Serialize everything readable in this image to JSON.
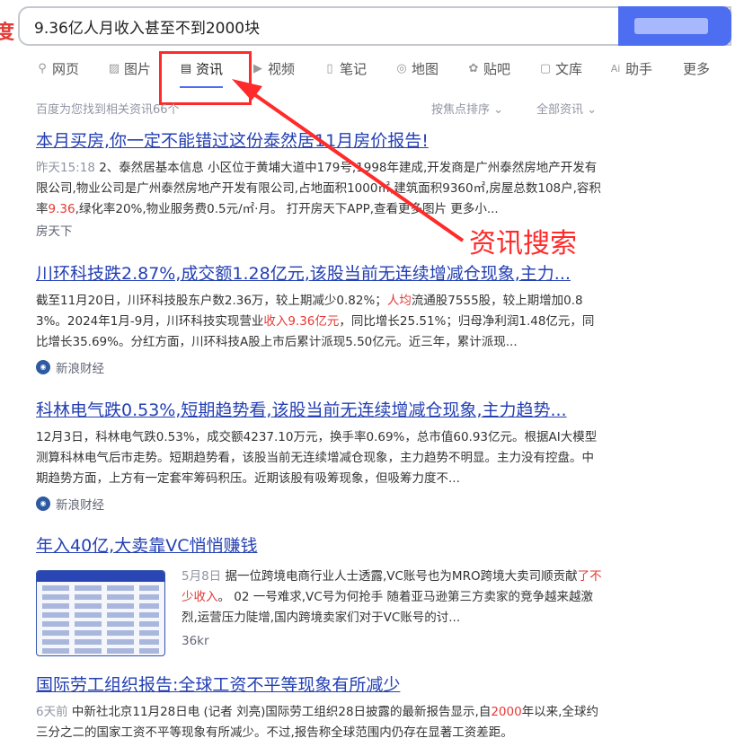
{
  "search": {
    "query": "9.36亿人月收入甚至不到2000块",
    "edge_char": "度"
  },
  "tabs": [
    {
      "label": "网页",
      "icon": "search-icon"
    },
    {
      "label": "图片",
      "icon": "image-icon"
    },
    {
      "label": "资讯",
      "icon": "news-icon",
      "active": true
    },
    {
      "label": "视频",
      "icon": "video-icon"
    },
    {
      "label": "笔记",
      "icon": "note-icon"
    },
    {
      "label": "地图",
      "icon": "map-pin-icon"
    },
    {
      "label": "贴吧",
      "icon": "paw-icon"
    },
    {
      "label": "文库",
      "icon": "document-icon"
    },
    {
      "label": "助手",
      "icon": "ai-icon"
    },
    {
      "label": "更多",
      "icon": ""
    }
  ],
  "result_summary": "百度为您找到相关资讯66个",
  "sort": {
    "focus": "按焦点排序",
    "all": "全部资讯"
  },
  "results": [
    {
      "title": "本月买房,你一定不能错过这份泰然居11月房价报告!",
      "date": "昨天15:18",
      "snippet_a": " 2、泰然居基本信息 小区位于黄埔大道中179号,1998年建成,开发商是广州泰然房地产开发有限公司,物业公司是广州泰然房地产开发有限公司,占地面积1000㎡,建筑面积9360㎡,房屋总数108户,容积率",
      "snippet_em": "9.36",
      "snippet_b": ",绿化率20%,物业服务费0.5元/㎡·月。 打开房天下APP,查看更多图片 更多小...",
      "source": "房天下"
    },
    {
      "title": "川环科技跌2.87%,成交额1.28亿元,该股当前无连续增减仓现象,主力...",
      "snippet_a": "截至11月20日，川环科技股东户数2.36万，较上期减少0.82%；",
      "snippet_em": "人均",
      "snippet_b": "流通股7555股，较上期增加0.83%。2024年1月-9月，川环科技实现营业",
      "snippet_em2": "收入9.36亿元",
      "snippet_c": "，同比增长25.51%；归母净利润1.48亿元，同比增长35.69%。分红方面，川环科技A股上市后累计派现5.50亿元。近三年，累计派现...",
      "source": "新浪财经"
    },
    {
      "title": "科林电气跌0.53%,短期趋势看,该股当前无连续增减仓现象,主力趋势...",
      "snippet": "12月3日，科林电气跌0.53%，成交额4237.10万元，换手率0.69%，总市值60.93亿元。根据AI大模型测算科林电气后市走势。短期趋势看，该股当前无连续增减仓现象，主力趋势不明显。主力没有控盘。中期趋势方面，上方有一定套牢筹码积压。近期该股有吸筹现象，但吸筹力度不...",
      "source": "新浪财经"
    },
    {
      "title": "年入40亿,大卖靠VC悄悄赚钱",
      "date": "5月8日",
      "snippet_a": " 据一位跨境电商行业人士透露,VC账号也为MRO跨境大卖司顺贡献",
      "snippet_em": "了不少收入",
      "snippet_b": "。 02 一号难求,VC号为何抢手 随着亚马逊第三方卖家的竞争越来越激烈,运营压力陡增,国内跨境卖家们对于VC账号的讨...",
      "source": "36kr"
    },
    {
      "title": "国际劳工组织报告:全球工资不平等现象有所减少",
      "date": "6天前",
      "snippet_a": " 中新社北京11月28日电 (记者 刘亮)国际劳工组织28日披露的最新报告显示,自",
      "snippet_em": "2000",
      "snippet_b": "年以来,全球约三分之二的国家工资不平等现象有所减少。不过,报告称全球范围内仍存在显著工资差距。"
    }
  ],
  "annotation": {
    "label": "资讯搜索",
    "color": "#ff2a2a"
  },
  "colors": {
    "link": "#2440b3",
    "accent": "#4e6ef2",
    "highlight": "#e53935"
  }
}
